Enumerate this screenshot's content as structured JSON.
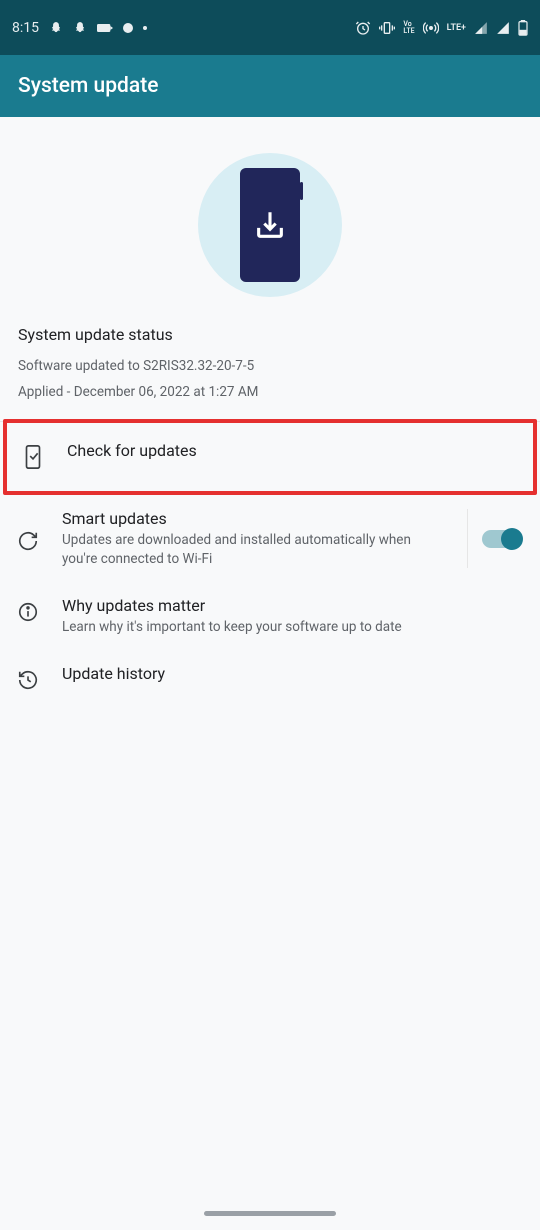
{
  "statusbar": {
    "time": "8:15",
    "network": "LTE+"
  },
  "appbar": {
    "title": "System update"
  },
  "status": {
    "heading": "System update status",
    "line1": "Software updated to S2RIS32.32-20-7-5",
    "line2": "Applied - December 06, 2022 at 1:27 AM"
  },
  "rows": {
    "check": {
      "title": "Check for updates"
    },
    "smart": {
      "title": "Smart updates",
      "sub": "Updates are downloaded and installed automatically when you're connected to Wi-Fi"
    },
    "why": {
      "title": "Why updates matter",
      "sub": "Learn why it's important to keep your software up to date"
    },
    "history": {
      "title": "Update history"
    }
  }
}
